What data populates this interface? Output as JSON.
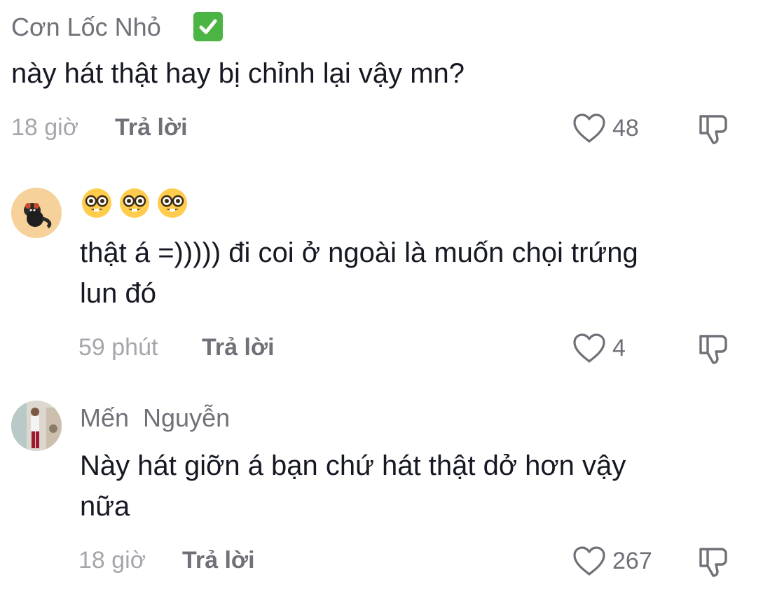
{
  "comments": [
    {
      "username": "Cơn Lốc Nhỏ",
      "verified": true,
      "text_lines": [
        "này hát thật hay bị chỉnh lại vậy mn?"
      ],
      "time": "18 giờ",
      "reply_label": "Trả lời",
      "likes": "48"
    },
    {
      "username_emoji": [
        "nerd-face-emoji",
        "nerd-face-emoji",
        "nerd-face-emoji"
      ],
      "text_lines": [
        "thật á =))))) đi coi ở ngoài là muốn chọi trứng",
        "lun đó"
      ],
      "time": "59 phút",
      "reply_label": "Trả lời",
      "likes": "4"
    },
    {
      "username": "Mến  Nguyễn",
      "text_lines": [
        "Này hát giỡn á bạn chứ hát thật dở hơn vậy",
        "nữa"
      ],
      "time": "18 giờ",
      "reply_label": "Trả lời",
      "likes": "267"
    }
  ],
  "icons": {
    "like": "heart-outline-icon",
    "dislike": "thumbs-down-icon",
    "verified": "verified-check-icon"
  },
  "colors": {
    "text": "#161823",
    "muted": "#6f7078",
    "time": "#a5a6ab",
    "verified": "#4bb543"
  }
}
